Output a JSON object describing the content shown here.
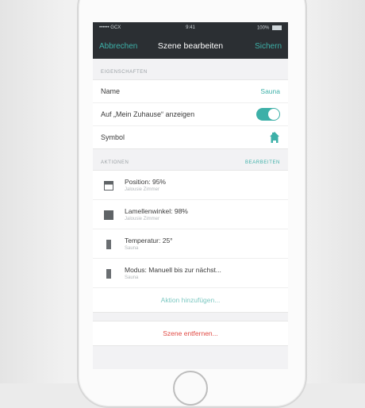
{
  "status_bar": {
    "carrier": "•••••• GCX",
    "time": "9:41",
    "battery": "100%"
  },
  "nav": {
    "cancel_label": "Abbrechen",
    "title": "Szene bearbeiten",
    "save_label": "Sichern"
  },
  "properties": {
    "section_label": "EIGENSCHAFTEN",
    "rows": [
      {
        "label": "Name",
        "value": "Sauna"
      },
      {
        "label": "Auf „Mein Zuhause“ anzeigen",
        "toggle_on": true
      },
      {
        "label": "Symbol",
        "icon": "house-icon"
      }
    ]
  },
  "actions": {
    "section_label": "AKTIONEN",
    "edit_label": "BEARBEITEN",
    "items": [
      {
        "icon": "blind-open-icon",
        "title": "Position: 95%",
        "subtitle": "Jalousie Zimmer"
      },
      {
        "icon": "blind-closed-icon",
        "title": "Lamellenwinkel: 98%",
        "subtitle": "Jalousie Zimmer"
      },
      {
        "icon": "thermostat-icon",
        "title": "Temperatur: 25°",
        "subtitle": "Sauna"
      },
      {
        "icon": "thermostat-icon",
        "title": "Modus: Manuell bis zur nächst...",
        "subtitle": "Sauna"
      }
    ],
    "add_label": "Aktion hinzufügen..."
  },
  "remove_label": "Szene entfernen...",
  "colors": {
    "accent": "#3db0a8",
    "destructive": "#e04a44",
    "topbar": "#2b2f33"
  }
}
